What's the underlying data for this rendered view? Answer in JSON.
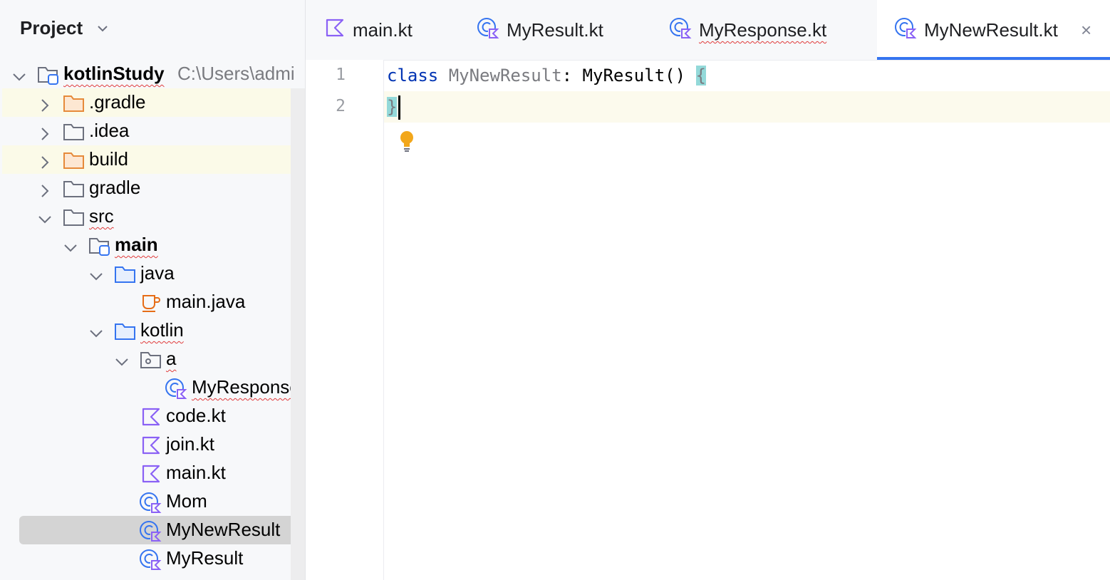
{
  "project_panel": {
    "title": "Project",
    "tree": [
      {
        "label": "kotlinStudy",
        "path": "C:\\Users\\admi"
      },
      {
        "label": ".gradle"
      },
      {
        "label": ".idea"
      },
      {
        "label": "build"
      },
      {
        "label": "gradle"
      },
      {
        "label": "src"
      },
      {
        "label": "main"
      },
      {
        "label": "java"
      },
      {
        "label": "main.java"
      },
      {
        "label": "kotlin"
      },
      {
        "label": "a"
      },
      {
        "label": "MyResponse"
      },
      {
        "label": "code.kt"
      },
      {
        "label": "join.kt"
      },
      {
        "label": "main.kt"
      },
      {
        "label": "Mom"
      },
      {
        "label": "MyNewResult"
      },
      {
        "label": "MyResult"
      }
    ]
  },
  "tabs": [
    {
      "label": "main.kt"
    },
    {
      "label": "MyResult.kt"
    },
    {
      "label": "MyResponse.kt"
    },
    {
      "label": "MyNewResult.kt",
      "close": "×"
    }
  ],
  "editor": {
    "line_numbers": [
      "1",
      "2"
    ],
    "line1": {
      "keyword": "class",
      "class_name": "MyNewResult",
      "rest": ": MyResult() ",
      "brace_open": "{"
    },
    "line2": {
      "brace_close": "}"
    }
  },
  "colors": {
    "accent": "#3574f0",
    "kotlin_icon": "#8a61f5",
    "class_icon": "#3574f0",
    "folder_orange": "#e68a3a",
    "error_squiggle": "#e03b3b",
    "brace_match": "#93d9d9",
    "bulb": "#f2a71b"
  }
}
